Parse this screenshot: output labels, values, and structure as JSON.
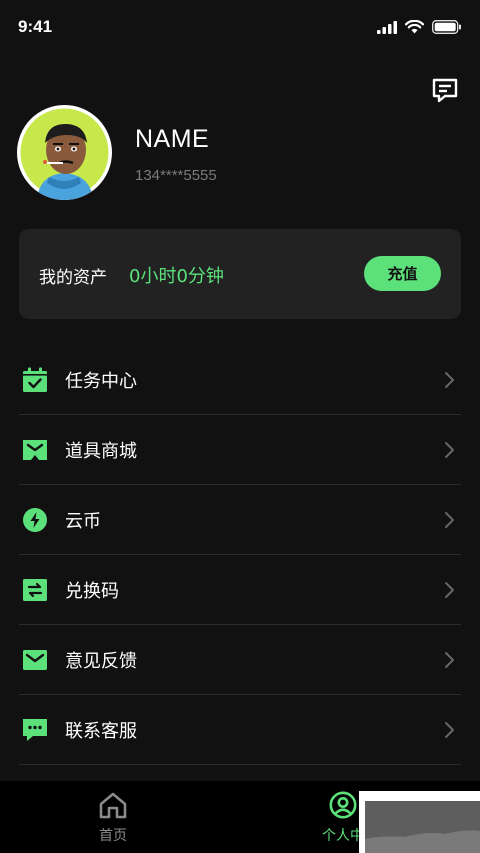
{
  "status_bar": {
    "time": "9:41"
  },
  "profile": {
    "name": "NAME",
    "phone": "134****5555"
  },
  "assets": {
    "label": "我的资产",
    "value": "0小时0分钟",
    "recharge_label": "充值"
  },
  "menu": {
    "items": [
      {
        "label": "任务中心",
        "icon": "calendar-check-icon"
      },
      {
        "label": "道具商城",
        "icon": "shop-icon"
      },
      {
        "label": "云币",
        "icon": "bolt-coin-icon"
      },
      {
        "label": "兑换码",
        "icon": "exchange-icon"
      },
      {
        "label": "意见反馈",
        "icon": "mail-icon"
      },
      {
        "label": "联系客服",
        "icon": "chat-icon"
      }
    ]
  },
  "tab_bar": {
    "tabs": [
      {
        "label": "首页",
        "icon": "home-icon",
        "active": false
      },
      {
        "label": "个人中",
        "icon": "user-icon",
        "active": true
      }
    ]
  },
  "colors": {
    "accent": "#5ce07a",
    "background": "#111111",
    "card": "#222222"
  }
}
